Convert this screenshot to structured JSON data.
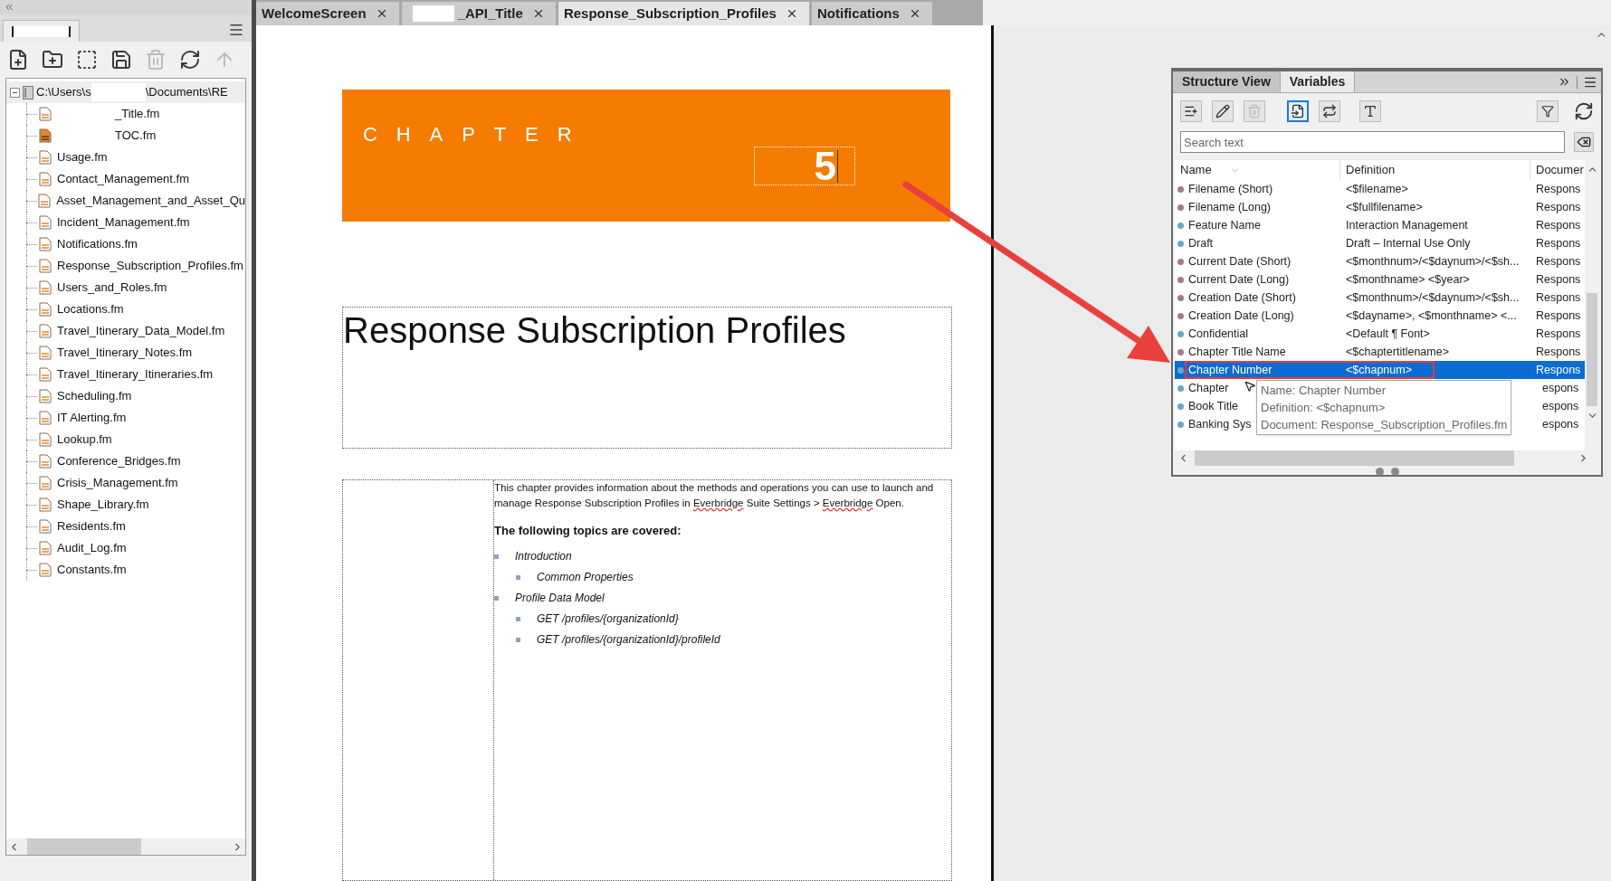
{
  "book_panel": {
    "toolbar": [
      {
        "kind": "new-file",
        "disabled": false
      },
      {
        "kind": "new-folder",
        "disabled": false
      },
      {
        "kind": "add-selection",
        "disabled": false
      },
      {
        "kind": "save",
        "disabled": false
      },
      {
        "kind": "delete",
        "disabled": true
      },
      {
        "kind": "refresh",
        "disabled": false
      },
      {
        "kind": "move-up",
        "disabled": true
      }
    ],
    "tree": {
      "label_start": "C:\\Users\\s",
      "label_end": "\\Documents\\RE",
      "expanded": true,
      "children": [
        {
          "label": "_Title.fm",
          "redacted": true,
          "open": false
        },
        {
          "label": "TOC.fm",
          "redacted": true,
          "open": true
        },
        {
          "label": "Usage.fm",
          "redacted": false,
          "open": false
        },
        {
          "label": "Contact_Management.fm",
          "redacted": false,
          "open": false
        },
        {
          "label": "Asset_Management_and_Asset_Qu",
          "redacted": false,
          "open": false
        },
        {
          "label": "Incident_Management.fm",
          "redacted": false,
          "open": false
        },
        {
          "label": "Notifications.fm",
          "redacted": false,
          "open": false
        },
        {
          "label": "Response_Subscription_Profiles.fm",
          "redacted": false,
          "open": false
        },
        {
          "label": "Users_and_Roles.fm",
          "redacted": false,
          "open": false
        },
        {
          "label": "Locations.fm",
          "redacted": false,
          "open": false
        },
        {
          "label": "Travel_Itinerary_Data_Model.fm",
          "redacted": false,
          "open": false
        },
        {
          "label": "Travel_Itinerary_Notes.fm",
          "redacted": false,
          "open": false
        },
        {
          "label": "Travel_Itinerary_Itineraries.fm",
          "redacted": false,
          "open": false
        },
        {
          "label": "Scheduling.fm",
          "redacted": false,
          "open": false
        },
        {
          "label": "IT Alerting.fm",
          "redacted": false,
          "open": false
        },
        {
          "label": "Lookup.fm",
          "redacted": false,
          "open": false
        },
        {
          "label": "Conference_Bridges.fm",
          "redacted": false,
          "open": false
        },
        {
          "label": "Crisis_Management.fm",
          "redacted": false,
          "open": false
        },
        {
          "label": "Shape_Library.fm",
          "redacted": false,
          "open": false
        },
        {
          "label": "Residents.fm",
          "redacted": false,
          "open": false
        },
        {
          "label": "Audit_Log.fm",
          "redacted": false,
          "open": false
        },
        {
          "label": "Constants.fm",
          "redacted": false,
          "open": false
        }
      ]
    }
  },
  "tabs": [
    {
      "label": "WelcomeScreen",
      "redacted": false,
      "selected": false
    },
    {
      "label": "_API_Title",
      "redacted": true,
      "selected": false
    },
    {
      "label": "Response_Subscription_Profiles",
      "redacted": false,
      "selected": true
    },
    {
      "label": "Notifications",
      "redacted": false,
      "selected": false
    }
  ],
  "document": {
    "chapter_label": "CHAPTER",
    "chapter_number": "5",
    "title": "Response Subscription Profiles",
    "intro": [
      {
        "text": "This chapter provides information about the methods and operations you can use to launch and manage Response Subscription Profiles in ",
        "misspelled": false
      },
      {
        "text": "Everbridge",
        "misspelled": true
      },
      {
        "text": " Suite Settings > ",
        "misspelled": false
      },
      {
        "text": "Everbridge",
        "misspelled": true
      },
      {
        "text": " Open.",
        "misspelled": false
      }
    ],
    "topics_heading": "The following topics are covered:",
    "topics": [
      {
        "label": "Introduction",
        "children": [
          {
            "label": "Common Properties"
          }
        ]
      },
      {
        "label": "Profile Data Model",
        "children": [
          {
            "label": "GET /profiles/{organizationId}"
          },
          {
            "label": "GET /profiles/{organizationId}/profileId"
          }
        ]
      }
    ]
  },
  "variables_panel": {
    "tabs": [
      {
        "label": "Structure View",
        "selected": false
      },
      {
        "label": "Variables",
        "selected": true
      }
    ],
    "toolbar": [
      {
        "kind": "add",
        "disabled": false,
        "selected": false
      },
      {
        "kind": "edit",
        "disabled": false,
        "selected": false
      },
      {
        "kind": "delete",
        "disabled": true,
        "selected": false
      },
      {
        "kind": "insert",
        "disabled": false,
        "selected": true
      },
      {
        "kind": "convert",
        "disabled": false,
        "selected": false
      },
      {
        "kind": "to-text",
        "disabled": false,
        "selected": false
      }
    ],
    "search": {
      "placeholder": "Search text"
    },
    "columns": [
      "Name",
      "Definition",
      "Documer"
    ],
    "rows": [
      {
        "name": "Filename (Short)",
        "definition": "<$filename>",
        "document": "Respons",
        "color": "#a07b90",
        "selected": false
      },
      {
        "name": "Filename (Long)",
        "definition": "<$fullfilename>",
        "document": "Respons",
        "color": "#a07b90",
        "selected": false
      },
      {
        "name": "Feature Name",
        "definition": "Interaction Management",
        "document": "Respons",
        "color": "#6aa5c8",
        "selected": false
      },
      {
        "name": "Draft",
        "definition": "Draft – Internal Use Only",
        "document": "Respons",
        "color": "#6aa5c8",
        "selected": false
      },
      {
        "name": "Current Date (Short)",
        "definition": "<$monthnum>/<$daynum>/<$sh...",
        "document": "Respons",
        "color": "#a07b90",
        "selected": false
      },
      {
        "name": "Current Date (Long)",
        "definition": "<$monthname> <$year>",
        "document": "Respons",
        "color": "#a07b90",
        "selected": false
      },
      {
        "name": "Creation Date (Short)",
        "definition": "<$monthnum>/<$daynum>/<$sh...",
        "document": "Respons",
        "color": "#a07b90",
        "selected": false
      },
      {
        "name": "Creation Date (Long)",
        "definition": "<$dayname>, <$monthname> <...",
        "document": "Respons",
        "color": "#a07b90",
        "selected": false
      },
      {
        "name": "Confidential",
        "definition": "<Default ¶ Font>",
        "document": "Respons",
        "color": "#6aa5c8",
        "selected": false
      },
      {
        "name": "Chapter Title Name",
        "definition": "<$chaptertitlename>",
        "document": "Respons",
        "color": "#a07b90",
        "selected": false
      },
      {
        "name": "Chapter Number",
        "definition": "<$chapnum>",
        "document": "Respons",
        "color": "#6aa5c8",
        "selected": true
      },
      {
        "name": "Chapter",
        "document": "espons",
        "color": "#6aa5c8",
        "selected": false
      },
      {
        "name": "Book Title",
        "document": "espons",
        "color": "#6aa5c8",
        "selected": false
      },
      {
        "name": "Banking Sys",
        "document": "espons",
        "color": "#6aa5c8",
        "selected": false
      }
    ],
    "tooltip": [
      "Name: Chapter Number",
      "Definition: <$chapnum>",
      "Document: Response_Subscription_Profiles.fm"
    ]
  }
}
